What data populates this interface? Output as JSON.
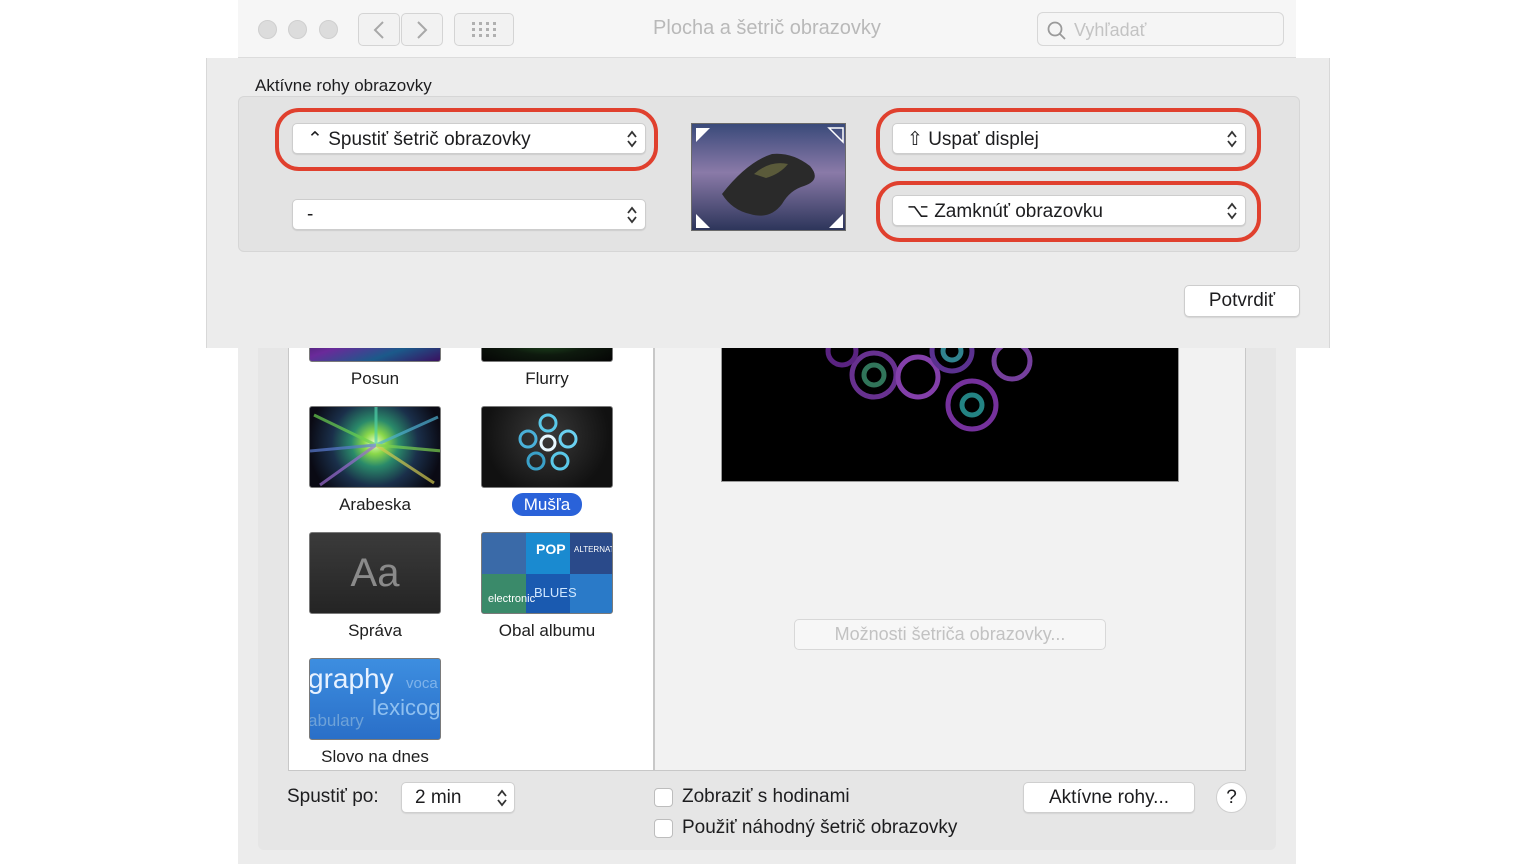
{
  "window": {
    "title": "Plocha a šetrič obrazovky",
    "search_placeholder": "Vyhľadať"
  },
  "sheet": {
    "title": "Aktívne rohy obrazovky",
    "top_left": "Spustiť šetrič obrazovky",
    "bottom_left": "-",
    "top_right": "Uspať displej",
    "bottom_right": "Zamknúť obrazovku",
    "top_left_modifier": "⌃",
    "top_right_modifier": "⇧",
    "bottom_right_modifier": "⌥",
    "confirm": "Potvrdiť"
  },
  "screensavers": {
    "items": [
      {
        "label": "Posun"
      },
      {
        "label": "Flurry"
      },
      {
        "label": "Arabeska"
      },
      {
        "label": "Mušľa",
        "selected": true
      },
      {
        "label": "Správa",
        "thumb_text": "Aa"
      },
      {
        "label": "Obal albumu"
      },
      {
        "label": "Slovo na dnes",
        "thumb_words": [
          "graphy",
          "voca",
          "lexicog",
          "abulary"
        ]
      }
    ],
    "album_words": [
      "POP",
      "ALTERNATIVE",
      "BLUES",
      "electronic"
    ]
  },
  "preview": {
    "options_button": "Možnosti šetriča obrazovky..."
  },
  "bottom": {
    "start_label": "Spustiť po:",
    "start_value": "2 min",
    "show_clock": "Zobraziť s hodinami",
    "random": "Použiť náhodný šetrič obrazovky",
    "hot_corners": "Aktívne rohy...",
    "help": "?"
  },
  "colors": {
    "highlight": "#e0402e",
    "selection": "#2a62d9"
  }
}
